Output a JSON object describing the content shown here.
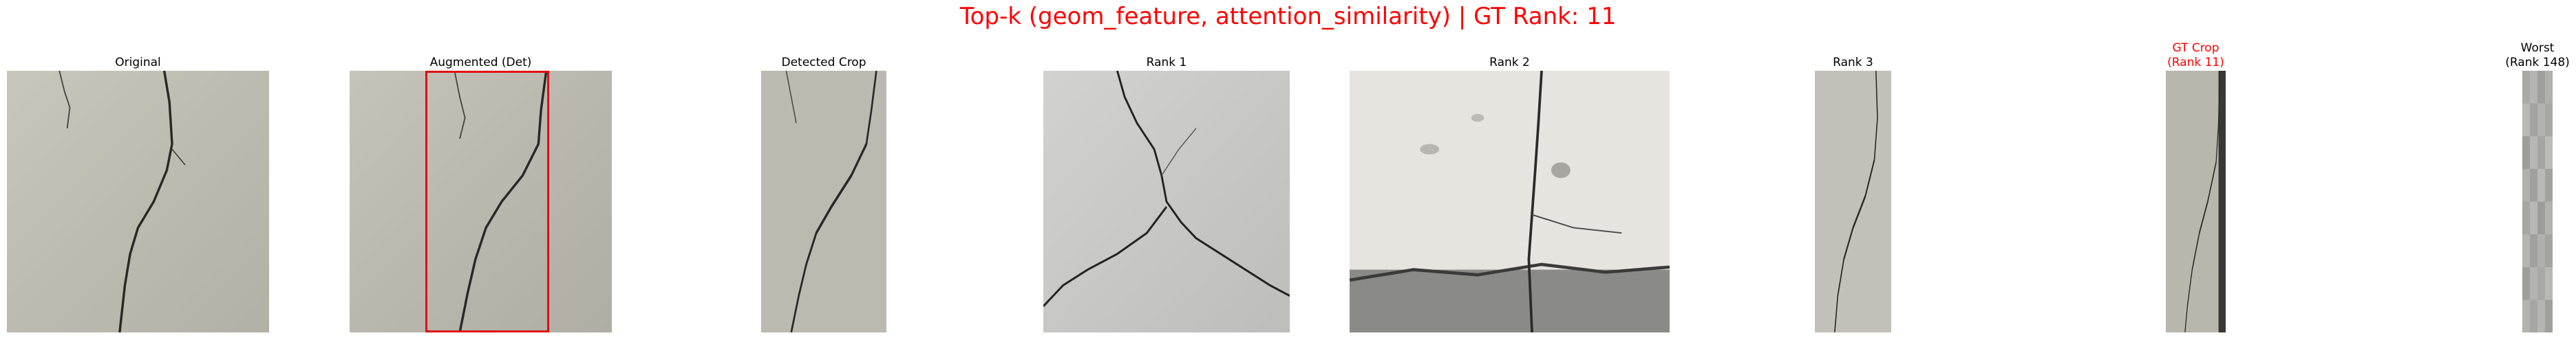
{
  "figure": {
    "title": "Top-k (geom_feature, attention_similarity) | GT Rank: 11",
    "title_color": "#ff0000",
    "highlight_color": "#ff0000",
    "box_color": "#e01010"
  },
  "panels": [
    {
      "title": "Original",
      "highlight": false
    },
    {
      "title": "Augmented (Det)",
      "highlight": false
    },
    {
      "title": "Detected Crop",
      "highlight": false
    },
    {
      "title": "Rank 1",
      "highlight": false
    },
    {
      "title": "Rank 2",
      "highlight": false
    },
    {
      "title": "Rank 3",
      "highlight": false
    },
    {
      "title": "GT Crop\n(Rank 11)",
      "highlight": true
    },
    {
      "title": "Worst\n(Rank 148)",
      "highlight": false
    }
  ]
}
